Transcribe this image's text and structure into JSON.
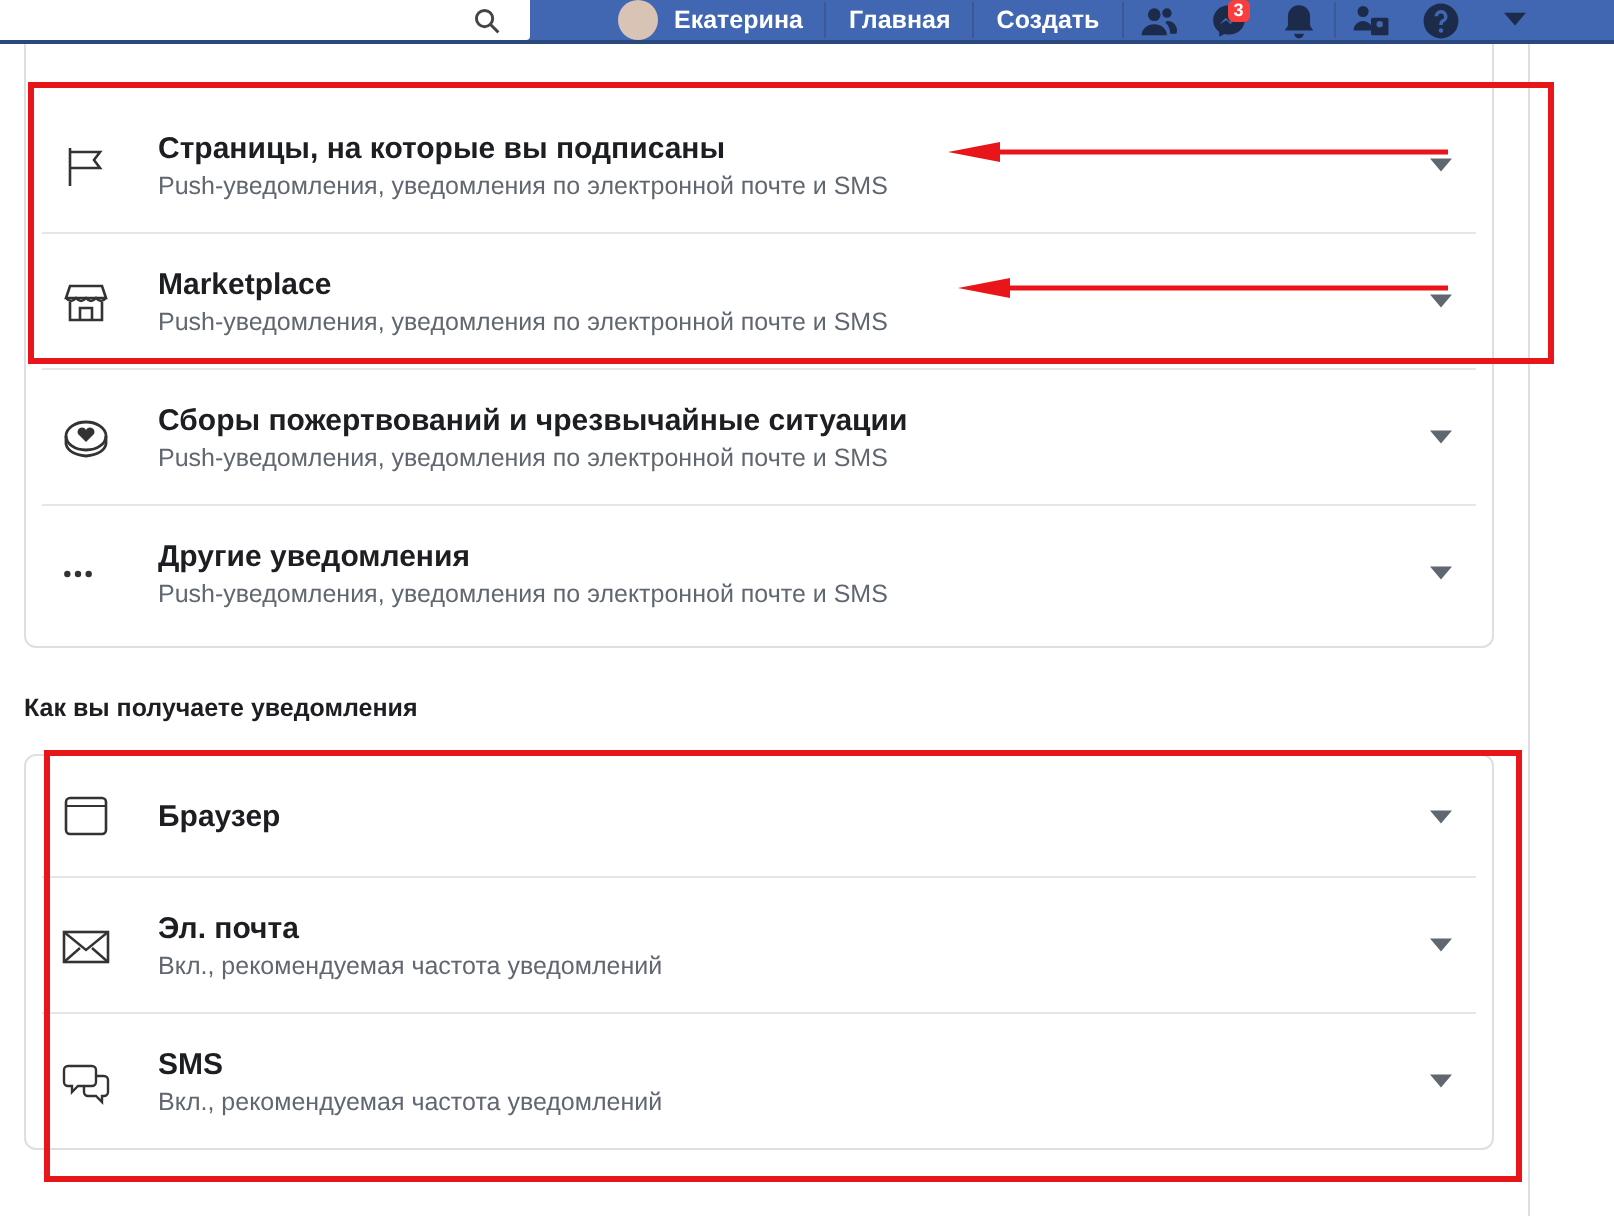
{
  "top_bar": {
    "user_name": "Екатерина",
    "nav": [
      "Главная",
      "Создать"
    ],
    "messages_badge": "3"
  },
  "notification_types": [
    {
      "title": "Страницы, на которые вы подписаны",
      "subtitle": "Push-уведомления, уведомления по электронной почте и SMS"
    },
    {
      "title": "Marketplace",
      "subtitle": "Push-уведомления, уведомления по электронной почте и SMS"
    },
    {
      "title": "Сборы пожертвований и чрезвычайные ситуации",
      "subtitle": "Push-уведомления, уведомления по электронной почте и SMS"
    },
    {
      "title": "Другие уведомления",
      "subtitle": "Push-уведомления, уведомления по электронной почте и SMS"
    }
  ],
  "delivery_heading": "Как вы получаете уведомления",
  "delivery_methods": [
    {
      "title": "Браузер"
    },
    {
      "title": "Эл. почта",
      "subtitle": "Вкл., рекомендуемая частота уведомлений"
    },
    {
      "title": "SMS",
      "subtitle": "Вкл., рекомендуемая частота уведомлений"
    }
  ]
}
